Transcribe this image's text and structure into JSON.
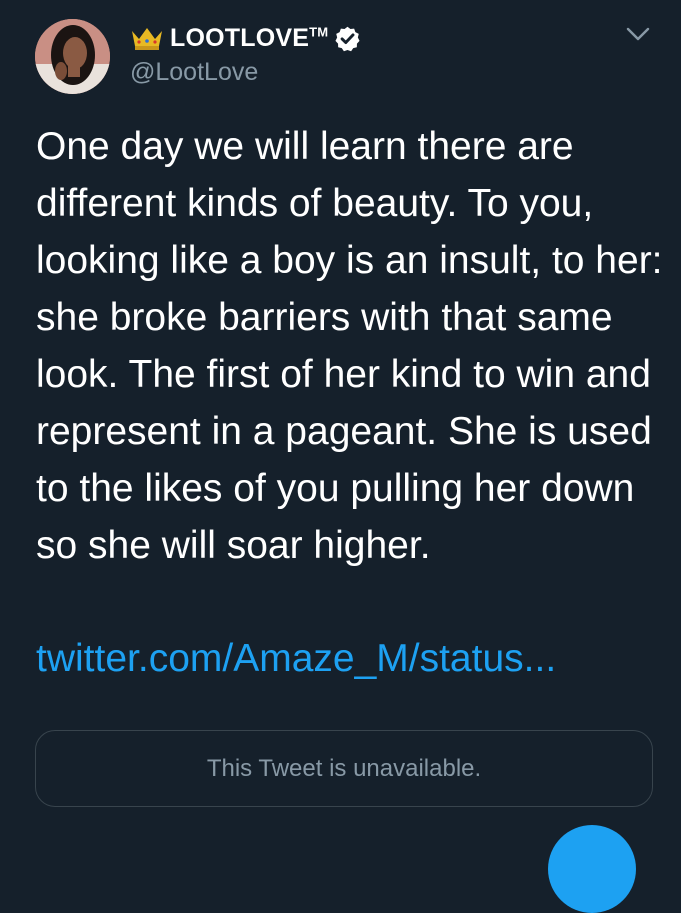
{
  "tweet": {
    "author": {
      "display_name": "LOOTLOVE",
      "trademark": "TM",
      "handle": "@LootLove",
      "verified": true,
      "avatar_icon": "avatar-photo-woman",
      "badge_icon": "crown-icon"
    },
    "text": "One day we will learn there are different kinds of beauty. To you, looking like a boy is an insult, to her: she broke barriers with that same look. The first of her kind to win and represent in a pageant. She is used to the likes of you pulling her down so she will soar higher.",
    "link": "twitter.com/Amaze_M/status...",
    "quoted_tweet_notice": "This Tweet is unavailable."
  },
  "colors": {
    "background": "#15202b",
    "primary_text": "#ffffff",
    "secondary_text": "#8899a6",
    "link": "#1da1f2",
    "border": "#38444d",
    "verified_badge": "#ffffff",
    "crown": "#e8b923"
  },
  "icons": {
    "menu": "chevron-down-icon",
    "fab": "compose-tweet-button"
  }
}
